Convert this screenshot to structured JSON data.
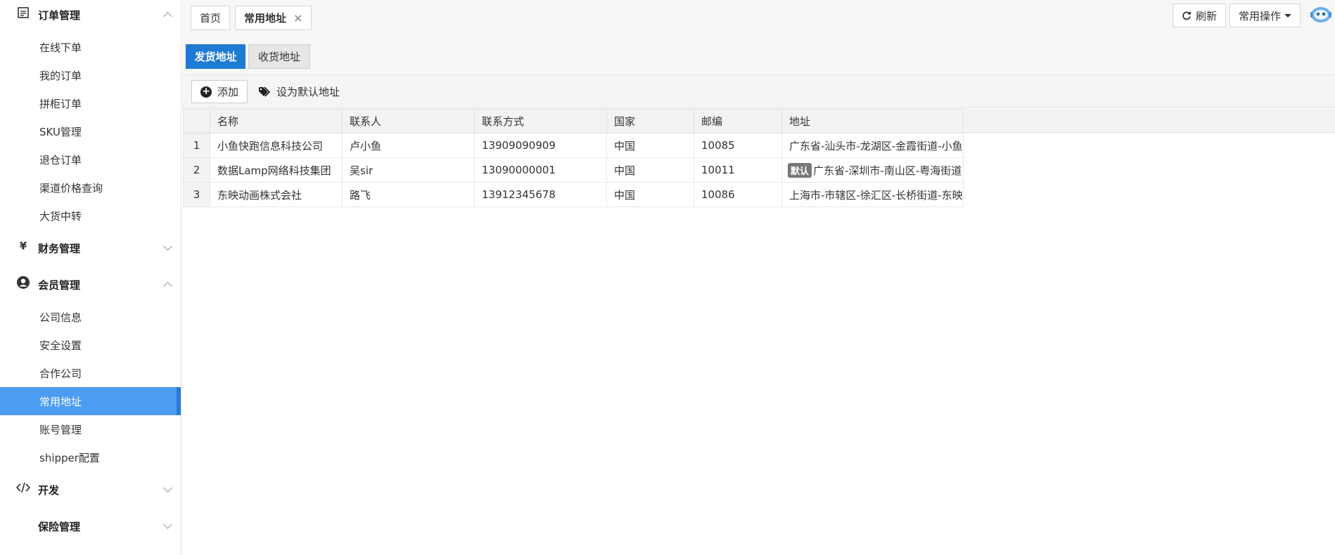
{
  "sidebar": {
    "groups": [
      {
        "label": "订单管理",
        "icon": "order-list-icon",
        "expanded": true,
        "items": [
          "在线下单",
          "我的订单",
          "拼柜订单",
          "SKU管理",
          "退仓订单",
          "渠道价格查询",
          "大货中转"
        ]
      },
      {
        "label": "财务管理",
        "icon": "yen-icon",
        "expanded": false,
        "items": []
      },
      {
        "label": "会员管理",
        "icon": "user-icon",
        "expanded": true,
        "items": [
          "公司信息",
          "安全设置",
          "合作公司",
          "常用地址",
          "账号管理",
          "shipper配置"
        ]
      },
      {
        "label": "开发",
        "icon": "code-icon",
        "expanded": false,
        "items": []
      },
      {
        "label": "保险管理",
        "icon": "",
        "expanded": false,
        "items": []
      }
    ],
    "active_item": "常用地址",
    "active_color": "#4c9df1"
  },
  "tabs": {
    "home": "首页",
    "current": "常用地址",
    "close": "×"
  },
  "header_actions": {
    "refresh": "刷新",
    "common_ops": "常用操作"
  },
  "subtabs": {
    "ship_from": "发货地址",
    "ship_to": "收货地址",
    "active_color": "#1e7bd4"
  },
  "toolbar": {
    "add": "添加",
    "set_default": "设为默认地址"
  },
  "table": {
    "columns": [
      "名称",
      "联系人",
      "联系方式",
      "国家",
      "邮编",
      "地址"
    ],
    "rows": [
      {
        "no": "1",
        "name": "小鱼快跑信息科技公司",
        "contact": "卢小鱼",
        "phone": "13909090909",
        "country": "中国",
        "zip": "10085",
        "badge": "",
        "address": "广东省-汕头市-龙湖区-金霞街道-小鱼"
      },
      {
        "no": "2",
        "name": "数据Lamp网络科技集团",
        "contact": "吴sir",
        "phone": "13090000001",
        "country": "中国",
        "zip": "10011",
        "badge": "默认",
        "address": "广东省-深圳市-南山区-粤海街道"
      },
      {
        "no": "3",
        "name": "东映动画株式会社",
        "contact": "路飞",
        "phone": "13912345678",
        "country": "中国",
        "zip": "10086",
        "badge": "",
        "address": "上海市-市辖区-徐汇区-长桥街道-东映"
      }
    ]
  }
}
